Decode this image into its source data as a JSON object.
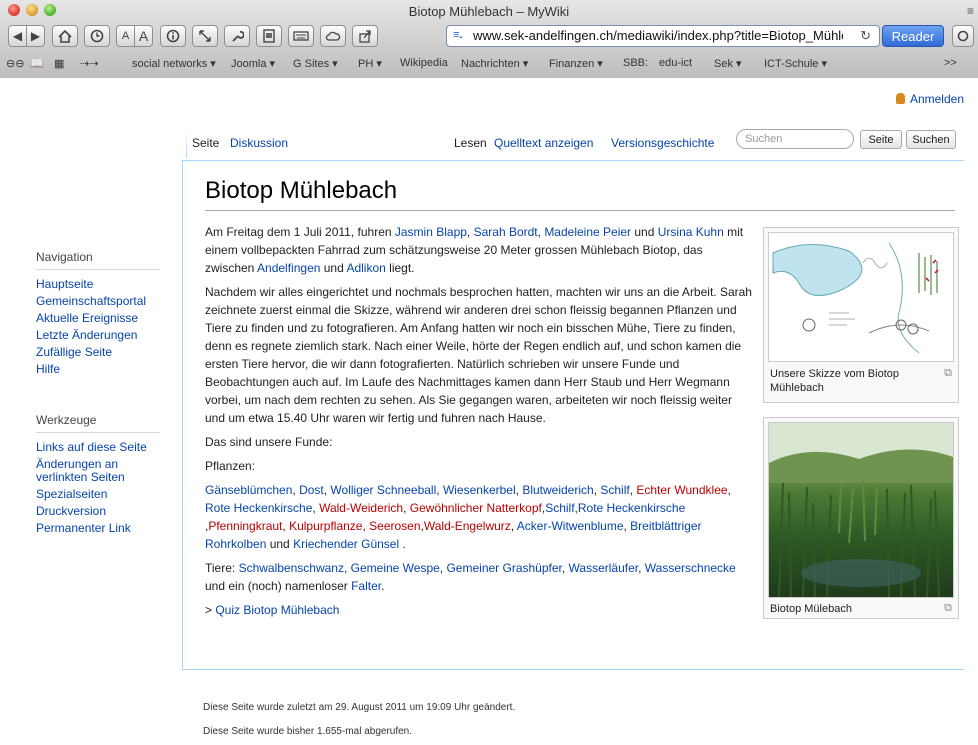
{
  "window": {
    "title": "Biotop Mühlebach – MyWiki",
    "edge_label": "≡"
  },
  "toolbar": {
    "url": "www.sek-andelfingen.ch/mediawiki/index.php?title=Biotop_Mühleb",
    "reader_label": "Reader",
    "reload_icon": "reload-icon",
    "small_a": "A",
    "large_a": "A"
  },
  "bookmarks": [
    "social networks ▾",
    "Joomla ▾",
    "G Sites ▾",
    "PH ▾",
    "Wikipedia",
    "Nachrichten ▾",
    "Finanzen ▾",
    "SBB:",
    "edu-ict",
    "Sek ▾",
    "ICT-Schule ▾",
    ">>"
  ],
  "page": {
    "login": "Anmelden",
    "tabs": {
      "seite": "Seite",
      "diskussion": "Diskussion",
      "lesen": "Lesen",
      "quelltext": "Quelltext anzeigen",
      "versionen": "Versionsgeschichte"
    },
    "search": {
      "placeholder": "Suchen",
      "go_label": "Seite",
      "search_label": "Suchen"
    },
    "sidebar": {
      "nav_heading": "Navigation",
      "nav_items": [
        "Hauptseite",
        "Gemeinschaftsportal",
        "Aktuelle Ereignisse",
        "Letzte Änderungen",
        "Zufällige Seite",
        "Hilfe"
      ],
      "tools_heading": "Werkzeuge",
      "tools_items": [
        "Links auf diese Seite",
        "Änderungen an",
        "verlinkten Seiten",
        "Spezialseiten",
        "Druckversion",
        "Permanenter Link"
      ]
    },
    "heading": "Biotop Mühlebach",
    "thumb1_caption": "Unsere Skizze vom Biotop Mühlebach",
    "thumb2_caption": "Biotop Mülebach",
    "para1": {
      "t1": "Am Freitag dem 1 Juli 2011, fuhren ",
      "l1": "Jasmin Blapp",
      "t2": ", ",
      "l2": "Sarah Bordt",
      "t3": ", ",
      "l3": "Madeleine Peier",
      "t4": " und ",
      "l4": "Ursina Kuhn",
      "t5": " mit einem vollbepackten Fahrrad zum schätzungsweise 20 Meter grossen Mühlebach Biotop, das zwischen ",
      "l5": "Andelfingen",
      "t6": " und ",
      "l6": "Adlikon",
      "t7": " liegt."
    },
    "para2": "Nachdem wir alles eingerichtet und nochmals besprochen hatten, machten wir uns an die Arbeit. Sarah zeichnete zuerst einmal die Skizze, während wir anderen drei schon fleissig begannen Pflanzen und Tiere zu finden und zu fotografieren. Am Anfang hatten wir noch ein bisschen Mühe, Tiere zu finden, denn es regnete ziemlich stark. Nach einer Weile, hörte der Regen endlich auf, und schon kamen die ersten Tiere hervor, die wir dann fotografierten. Natürlich schrieben wir unsere Funde und Beobachtungen auch auf. Im Laufe des Nachmittages kamen dann Herr Staub und Herr Wegmann vorbei, um nach dem rechten zu sehen. Als Sie gegangen waren, arbeiteten wir noch fleissig weiter und um etwa 15.40 Uhr waren wir fertig und fuhren nach Hause.",
    "para3": "Das sind unsere Funde:",
    "para4": "Pflanzen:",
    "plants": {
      "p1": "Gänseblümchen",
      "c1": ", ",
      "p2": "Dost",
      "c2": ", ",
      "p3": "Wolliger Schneeball",
      "c3": ", ",
      "p4": "Wiesenkerbel",
      "c4": ", ",
      "p5": "Blutweiderich",
      "c5": ", ",
      "p6": "Schilf",
      "c6": ", ",
      "p7": "Echter Wundklee",
      "c7": ", ",
      "p8": "Rote Heckenkirsche",
      "c8": ", ",
      "p9": "Wald-Weiderich",
      "c9": ", ",
      "p10": "Gewöhnlicher Natterkopf",
      "c10": ",",
      "p11": "Schilf",
      "c11": ",",
      "p12": "Rote Heckenkirsche",
      "c12": " ,",
      "p13": "Pfenningkraut",
      "c13": ", ",
      "p14": "Kulpurpflanze",
      "c14": ", ",
      "p15": "Seerosen",
      "c15": ",",
      "p16": "Wald-Engelwurz",
      "c16": ", ",
      "p17": "Acker-Witwenblume",
      "c17": ", ",
      "p18": "Breitblättriger Rohrkolben",
      "c18": " und ",
      "p19": "Kriechender Günsel",
      "c19": " ."
    },
    "animals": {
      "t0": "Tiere: ",
      "a1": "Schwalbenschwanz",
      "c1": ", ",
      "a2": "Gemeine Wespe",
      "c2": ", ",
      "a3": "Gemeiner Grashüpfer",
      "c3": ", ",
      "a4": "Wasserläufer",
      "c4": ", ",
      "a5": "Wasserschnecke",
      "c5": " und ein (noch) namenloser ",
      "a6": "Falter",
      "c6": "."
    },
    "quiz_prefix": "> ",
    "quiz_link": "Quiz Biotop Mühlebach",
    "footer1": "Diese Seite wurde zuletzt am 29. August 2011 um 19:09 Uhr geändert.",
    "footer2": "Diese Seite wurde bisher 1.655-mal abgerufen."
  }
}
